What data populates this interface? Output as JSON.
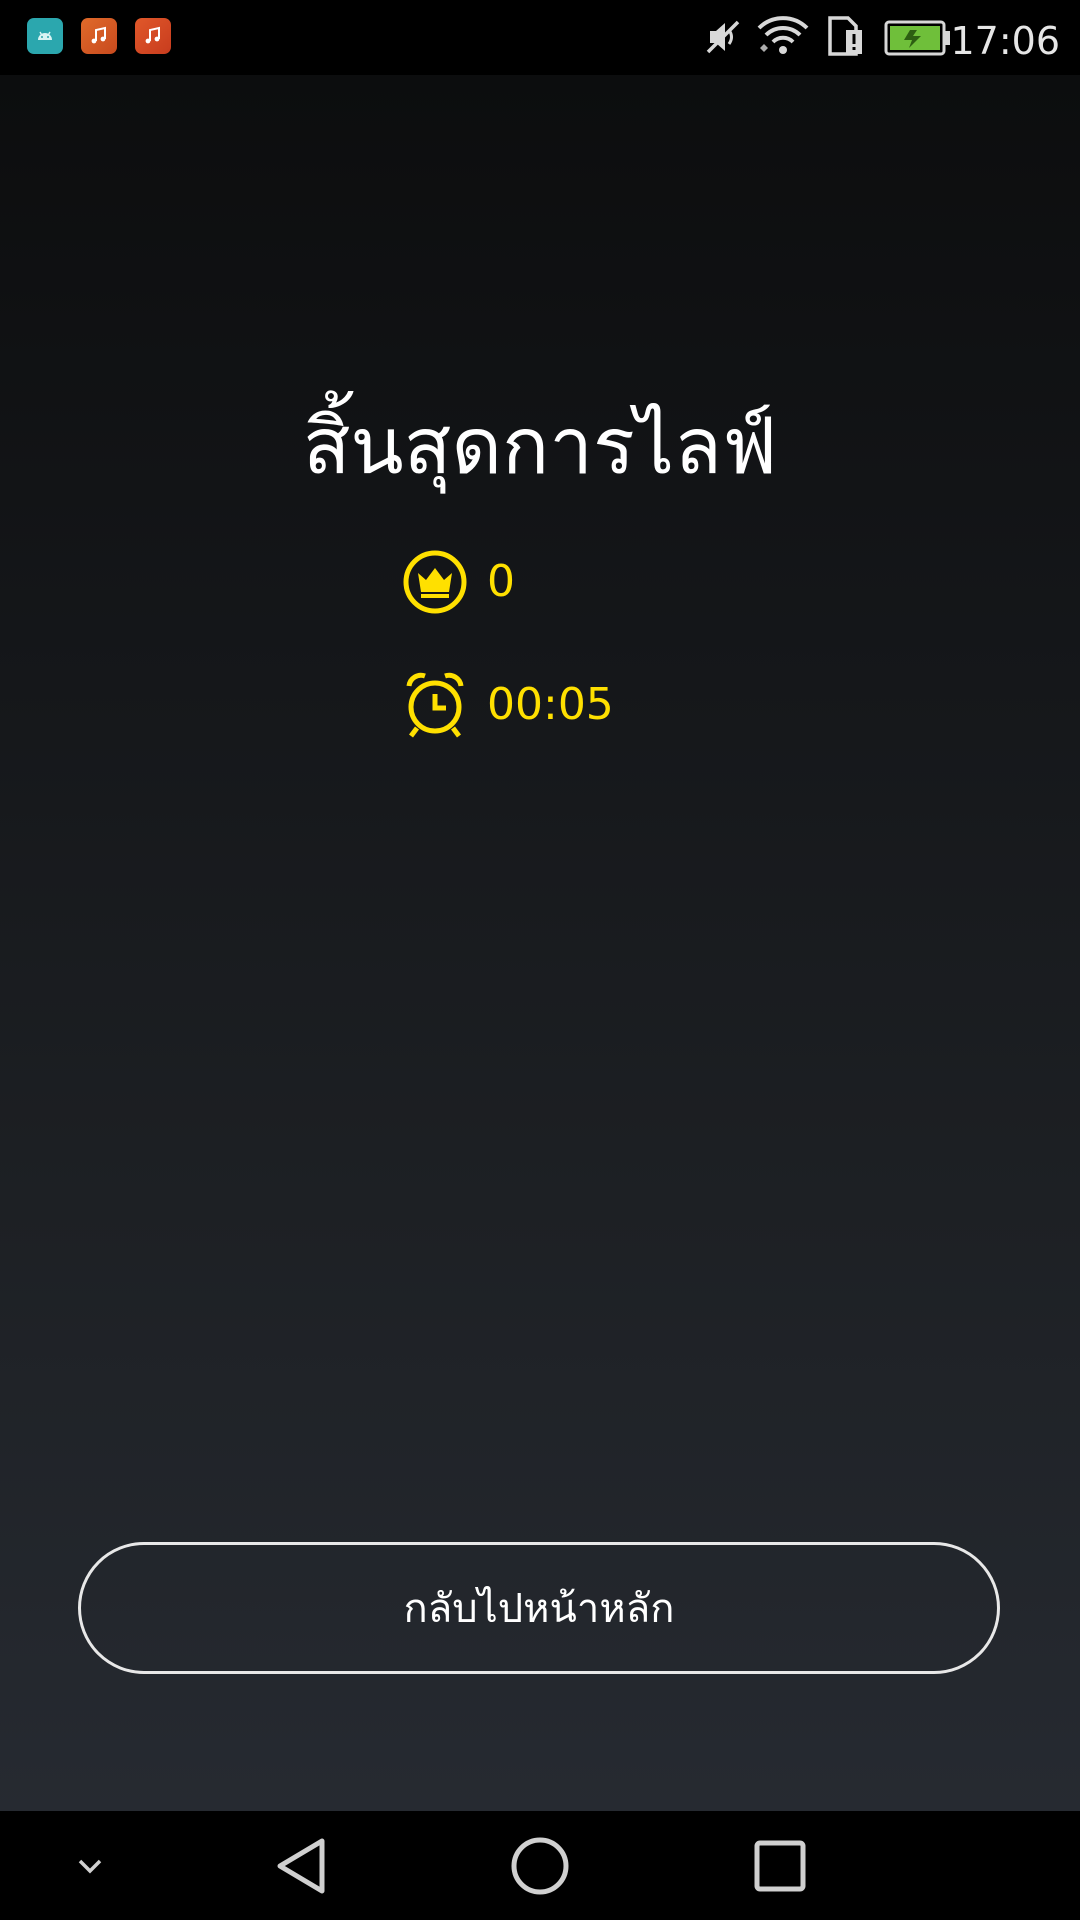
{
  "status_bar": {
    "time": "17:06",
    "notification_icons": [
      "android-icon",
      "music-app-icon",
      "music-app-icon"
    ],
    "status_icons": [
      "mute-icon",
      "wifi-icon",
      "sim-alert-icon",
      "battery-charging-icon"
    ]
  },
  "result": {
    "title": "สิ้นสุดการไลฟ์",
    "score": "0",
    "duration": "00:05"
  },
  "actions": {
    "home_button_label": "กลับไปหน้าหลัก"
  },
  "nav_bar": {
    "buttons": [
      "hide-keyboard-icon",
      "back-icon",
      "home-icon",
      "recents-icon"
    ]
  },
  "colors": {
    "accent_yellow": "#ffe000",
    "text_white": "#ffffff",
    "battery_green": "#6fbf3a"
  }
}
